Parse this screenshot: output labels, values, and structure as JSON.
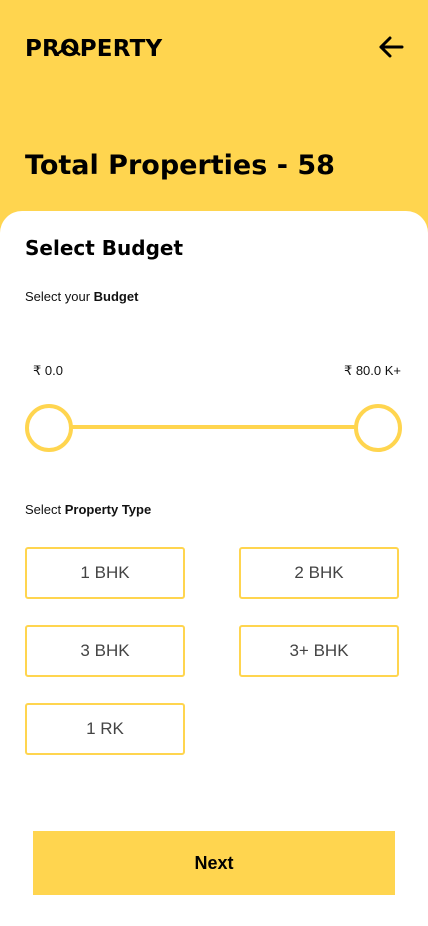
{
  "header": {
    "logo_text": "PROPERTY",
    "back_icon": "arrow-left-icon",
    "total_label": "Total Properties - 58"
  },
  "budget": {
    "section_title": "Select Budget",
    "subtitle_prefix": "Select your ",
    "subtitle_bold": "Budget",
    "min_label": "₹ 0.0",
    "max_label": "₹ 80.0 K+",
    "range_low_fraction": 0,
    "range_high_fraction": 1
  },
  "property_type": {
    "subtitle_prefix": "Select ",
    "subtitle_bold": "Property Type",
    "options": [
      "1 BHK",
      "2 BHK",
      "3 BHK",
      "3+ BHK",
      "1 RK"
    ]
  },
  "next_button": "Next",
  "colors": {
    "accent": "#FFD54F",
    "background": "#FFFFFF"
  }
}
